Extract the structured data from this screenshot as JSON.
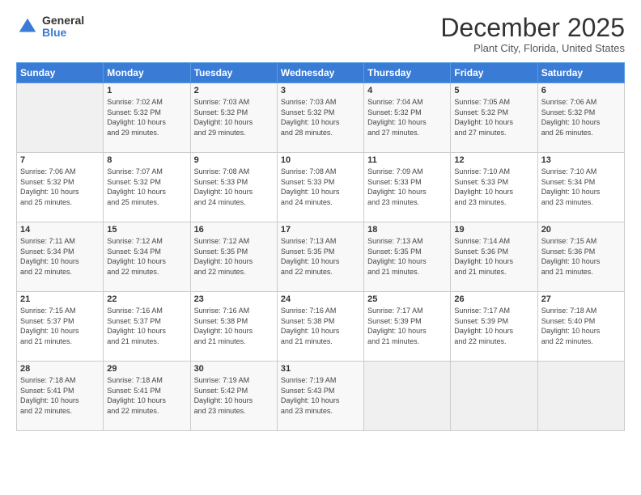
{
  "logo": {
    "general": "General",
    "blue": "Blue"
  },
  "header": {
    "month": "December 2025",
    "location": "Plant City, Florida, United States"
  },
  "days_of_week": [
    "Sunday",
    "Monday",
    "Tuesday",
    "Wednesday",
    "Thursday",
    "Friday",
    "Saturday"
  ],
  "weeks": [
    [
      {
        "day": "",
        "info": ""
      },
      {
        "day": "1",
        "info": "Sunrise: 7:02 AM\nSunset: 5:32 PM\nDaylight: 10 hours\nand 29 minutes."
      },
      {
        "day": "2",
        "info": "Sunrise: 7:03 AM\nSunset: 5:32 PM\nDaylight: 10 hours\nand 29 minutes."
      },
      {
        "day": "3",
        "info": "Sunrise: 7:03 AM\nSunset: 5:32 PM\nDaylight: 10 hours\nand 28 minutes."
      },
      {
        "day": "4",
        "info": "Sunrise: 7:04 AM\nSunset: 5:32 PM\nDaylight: 10 hours\nand 27 minutes."
      },
      {
        "day": "5",
        "info": "Sunrise: 7:05 AM\nSunset: 5:32 PM\nDaylight: 10 hours\nand 27 minutes."
      },
      {
        "day": "6",
        "info": "Sunrise: 7:06 AM\nSunset: 5:32 PM\nDaylight: 10 hours\nand 26 minutes."
      }
    ],
    [
      {
        "day": "7",
        "info": "Sunrise: 7:06 AM\nSunset: 5:32 PM\nDaylight: 10 hours\nand 25 minutes."
      },
      {
        "day": "8",
        "info": "Sunrise: 7:07 AM\nSunset: 5:32 PM\nDaylight: 10 hours\nand 25 minutes."
      },
      {
        "day": "9",
        "info": "Sunrise: 7:08 AM\nSunset: 5:33 PM\nDaylight: 10 hours\nand 24 minutes."
      },
      {
        "day": "10",
        "info": "Sunrise: 7:08 AM\nSunset: 5:33 PM\nDaylight: 10 hours\nand 24 minutes."
      },
      {
        "day": "11",
        "info": "Sunrise: 7:09 AM\nSunset: 5:33 PM\nDaylight: 10 hours\nand 23 minutes."
      },
      {
        "day": "12",
        "info": "Sunrise: 7:10 AM\nSunset: 5:33 PM\nDaylight: 10 hours\nand 23 minutes."
      },
      {
        "day": "13",
        "info": "Sunrise: 7:10 AM\nSunset: 5:34 PM\nDaylight: 10 hours\nand 23 minutes."
      }
    ],
    [
      {
        "day": "14",
        "info": "Sunrise: 7:11 AM\nSunset: 5:34 PM\nDaylight: 10 hours\nand 22 minutes."
      },
      {
        "day": "15",
        "info": "Sunrise: 7:12 AM\nSunset: 5:34 PM\nDaylight: 10 hours\nand 22 minutes."
      },
      {
        "day": "16",
        "info": "Sunrise: 7:12 AM\nSunset: 5:35 PM\nDaylight: 10 hours\nand 22 minutes."
      },
      {
        "day": "17",
        "info": "Sunrise: 7:13 AM\nSunset: 5:35 PM\nDaylight: 10 hours\nand 22 minutes."
      },
      {
        "day": "18",
        "info": "Sunrise: 7:13 AM\nSunset: 5:35 PM\nDaylight: 10 hours\nand 21 minutes."
      },
      {
        "day": "19",
        "info": "Sunrise: 7:14 AM\nSunset: 5:36 PM\nDaylight: 10 hours\nand 21 minutes."
      },
      {
        "day": "20",
        "info": "Sunrise: 7:15 AM\nSunset: 5:36 PM\nDaylight: 10 hours\nand 21 minutes."
      }
    ],
    [
      {
        "day": "21",
        "info": "Sunrise: 7:15 AM\nSunset: 5:37 PM\nDaylight: 10 hours\nand 21 minutes."
      },
      {
        "day": "22",
        "info": "Sunrise: 7:16 AM\nSunset: 5:37 PM\nDaylight: 10 hours\nand 21 minutes."
      },
      {
        "day": "23",
        "info": "Sunrise: 7:16 AM\nSunset: 5:38 PM\nDaylight: 10 hours\nand 21 minutes."
      },
      {
        "day": "24",
        "info": "Sunrise: 7:16 AM\nSunset: 5:38 PM\nDaylight: 10 hours\nand 21 minutes."
      },
      {
        "day": "25",
        "info": "Sunrise: 7:17 AM\nSunset: 5:39 PM\nDaylight: 10 hours\nand 21 minutes."
      },
      {
        "day": "26",
        "info": "Sunrise: 7:17 AM\nSunset: 5:39 PM\nDaylight: 10 hours\nand 22 minutes."
      },
      {
        "day": "27",
        "info": "Sunrise: 7:18 AM\nSunset: 5:40 PM\nDaylight: 10 hours\nand 22 minutes."
      }
    ],
    [
      {
        "day": "28",
        "info": "Sunrise: 7:18 AM\nSunset: 5:41 PM\nDaylight: 10 hours\nand 22 minutes."
      },
      {
        "day": "29",
        "info": "Sunrise: 7:18 AM\nSunset: 5:41 PM\nDaylight: 10 hours\nand 22 minutes."
      },
      {
        "day": "30",
        "info": "Sunrise: 7:19 AM\nSunset: 5:42 PM\nDaylight: 10 hours\nand 23 minutes."
      },
      {
        "day": "31",
        "info": "Sunrise: 7:19 AM\nSunset: 5:43 PM\nDaylight: 10 hours\nand 23 minutes."
      },
      {
        "day": "",
        "info": ""
      },
      {
        "day": "",
        "info": ""
      },
      {
        "day": "",
        "info": ""
      }
    ]
  ]
}
